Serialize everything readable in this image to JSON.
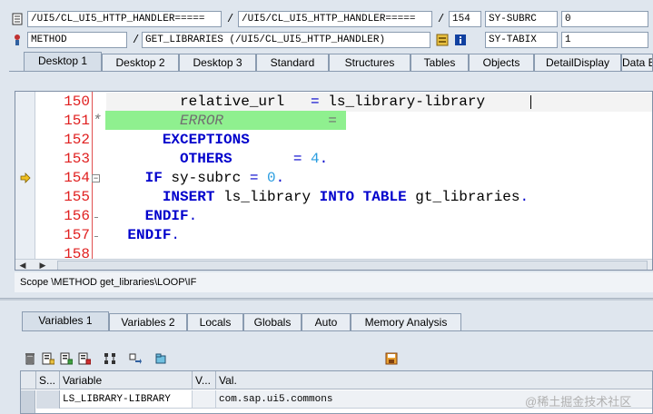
{
  "header": {
    "row1": {
      "program": "/UI5/CL_UI5_HTTP_HANDLER=====",
      "include": "/UI5/CL_UI5_HTTP_HANDLER=====",
      "line": "154",
      "field_name": "SY-SUBRC",
      "field_value": "0"
    },
    "row2": {
      "event_type": "METHOD",
      "event": "GET_LIBRARIES (/UI5/CL_UI5_HTTP_HANDLER)",
      "field_name": "SY-TABIX",
      "field_value": "1"
    },
    "separator": "/"
  },
  "desktop_tabs": [
    "Desktop 1",
    "Desktop 2",
    "Desktop 3",
    "Standard",
    "Structures",
    "Tables",
    "Objects",
    "DetailDisplay",
    "Data E"
  ],
  "editor": {
    "lines": [
      {
        "no": "150",
        "parts": [
          [
            "id",
            "          relative_url   "
          ],
          [
            "op",
            "= "
          ],
          [
            "id",
            "ls_library-library"
          ]
        ]
      },
      {
        "no": "151",
        "parts": [
          [
            "cm",
            "*         ERROR            ="
          ]
        ]
      },
      {
        "no": "152",
        "parts": [
          [
            "kw",
            "        EXCEPTIONS"
          ]
        ]
      },
      {
        "no": "153",
        "parts": [
          [
            "kw",
            "          OTHERS"
          ],
          [
            "id",
            "       "
          ],
          [
            "op",
            "= "
          ],
          [
            "num",
            "4"
          ],
          [
            "op",
            "."
          ]
        ]
      },
      {
        "no": "154",
        "parts": [
          [
            "kw",
            "      IF "
          ],
          [
            "id",
            "sy-subrc "
          ],
          [
            "op",
            "= "
          ],
          [
            "num",
            "0"
          ],
          [
            "op",
            "."
          ]
        ]
      },
      {
        "no": "155",
        "parts": [
          [
            "kw",
            "        INSERT "
          ],
          [
            "id",
            "ls_library "
          ],
          [
            "kw",
            "INTO TABLE "
          ],
          [
            "id",
            "gt_libraries"
          ],
          [
            "op",
            "."
          ]
        ]
      },
      {
        "no": "156",
        "parts": [
          [
            "kw",
            "      ENDIF"
          ],
          [
            "op",
            "."
          ]
        ]
      },
      {
        "no": "157",
        "parts": [
          [
            "kw",
            "    ENDIF"
          ],
          [
            "op",
            "."
          ]
        ]
      },
      {
        "no": "158",
        "parts": [
          [
            "id",
            ""
          ]
        ]
      }
    ]
  },
  "scope": "Scope \\METHOD get_libraries\\LOOP\\IF",
  "variable_tabs": [
    "Variables 1",
    "Variables 2",
    "Locals",
    "Globals",
    "Auto",
    "Memory Analysis"
  ],
  "table": {
    "columns": [
      "S...",
      "Variable",
      "V...",
      "Val."
    ],
    "rows": [
      {
        "variable": "LS_LIBRARY-LIBRARY",
        "value": "com.sap.ui5.commons"
      }
    ]
  },
  "watermark": "@稀土掘金技术社区",
  "colors": {
    "keyword": "#0000cc",
    "number": "#2a9de0",
    "line_number": "#e02020",
    "highlight": "#8ff08f",
    "background": "#dfe6ee"
  }
}
